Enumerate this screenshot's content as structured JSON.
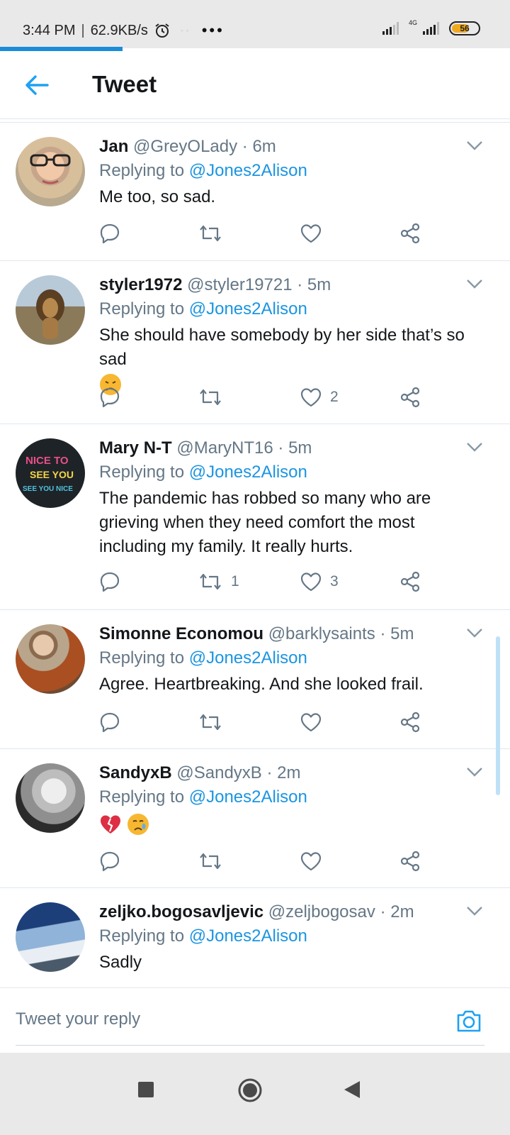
{
  "status_bar": {
    "time": "3:44 PM",
    "net_speed": "62.9KB/s",
    "more": "•••",
    "network_type": "4G",
    "battery": "56"
  },
  "page_load_progress": 0.24,
  "header": {
    "title": "Tweet"
  },
  "tweets": [
    {
      "name": "Jan",
      "handle": "@GreyOLady",
      "time": "· 6m",
      "replying_prefix": "Replying to",
      "replying_to": "@Jones2Alison",
      "text": "Me too, so sad.",
      "reply_count": "",
      "retweet_count": "",
      "like_count": ""
    },
    {
      "name": "styler1972",
      "handle": "@styler19721",
      "time": "· 5m",
      "replying_prefix": "Replying to",
      "replying_to": "@Jones2Alison",
      "text": "She should have somebody by her side  that’s so sad",
      "reply_count": "",
      "retweet_count": "",
      "like_count": "2"
    },
    {
      "name": "Mary N-T",
      "handle": "@MaryNT16",
      "time": "· 5m",
      "replying_prefix": "Replying to",
      "replying_to": "@Jones2Alison",
      "text": "The pandemic has robbed so many who are grieving when they need comfort the most including my family. It really hurts.",
      "reply_count": "",
      "retweet_count": "1",
      "like_count": "3",
      "avatar_text": [
        "NICE TO",
        "SEE YOU",
        "SEE YOU NICE"
      ]
    },
    {
      "name": "Simonne Economou",
      "handle": "@barklysaints",
      "time": "· 5m",
      "replying_prefix": "Replying to",
      "replying_to": "@Jones2Alison",
      "text": "Agree. Heartbreaking. And she looked frail.",
      "reply_count": "",
      "retweet_count": "",
      "like_count": ""
    },
    {
      "name": "SandyxB",
      "handle": "@SandyxB",
      "time": "· 2m",
      "replying_prefix": "Replying to",
      "replying_to": "@Jones2Alison",
      "text": "",
      "reply_count": "",
      "retweet_count": "",
      "like_count": ""
    },
    {
      "name": "zeljko.bogosavljevic",
      "handle": "@zeljbogosav",
      "time": "· 2m",
      "replying_prefix": "Replying to",
      "replying_to": "@Jones2Alison",
      "text": "Sadly"
    }
  ],
  "reply_bar": {
    "placeholder": "Tweet your reply"
  },
  "colors": {
    "accent": "#1b95e0",
    "text": "#14171a",
    "muted": "#657786",
    "divider": "#e1e8ed",
    "system_bar": "#e9e9ea"
  },
  "icons": [
    "back-arrow-icon",
    "reply-icon",
    "retweet-icon",
    "like-icon",
    "share-icon",
    "chevron-down-icon",
    "camera-icon",
    "alarm-icon"
  ]
}
